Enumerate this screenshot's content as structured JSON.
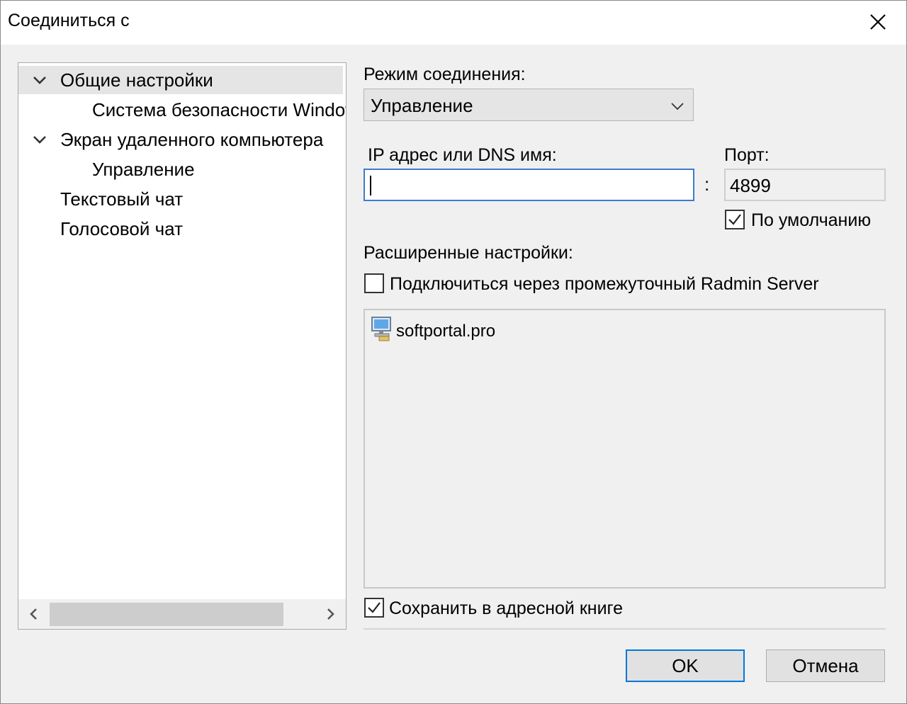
{
  "window": {
    "title": "Соединиться с"
  },
  "tree": {
    "items": [
      {
        "label": "Общие настройки",
        "expanded": true,
        "selected": true
      },
      {
        "label": "Система безопасности Windows"
      },
      {
        "label": "Экран удаленного компьютера",
        "expanded": true
      },
      {
        "label": "Управление"
      },
      {
        "label": "Текстовый чат"
      },
      {
        "label": "Голосовой чат"
      }
    ]
  },
  "mode": {
    "label": "Режим соединения:",
    "value": "Управление"
  },
  "address": {
    "label": "IP адрес или DNS имя:",
    "value": ""
  },
  "port": {
    "label": "Порт:",
    "value": "4899",
    "separator": ":"
  },
  "default_port": {
    "label": "По умолчанию",
    "checked": true
  },
  "advanced": {
    "label": "Расширенные настройки:"
  },
  "via_server": {
    "label": "Подключиться через промежуточный Radmin Server",
    "checked": false
  },
  "server_list": {
    "items": [
      {
        "name": "softportal.pro",
        "icon": "computer-icon"
      }
    ]
  },
  "save_address": {
    "label": "Сохранить в адресной книге",
    "checked": true
  },
  "buttons": {
    "ok": "OK",
    "cancel": "Отмена"
  },
  "colors": {
    "accent": "#0078d7",
    "selection": "#e5e5e5",
    "focus_border": "#3d7bd0"
  }
}
